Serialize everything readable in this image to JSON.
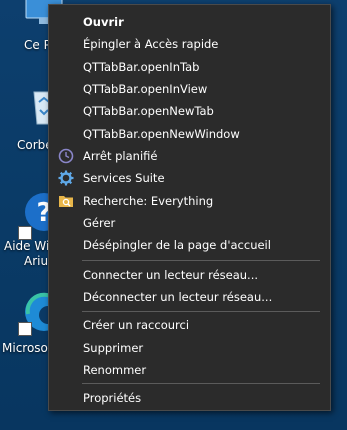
{
  "desktop": {
    "icons": [
      {
        "label": "Ce P",
        "icon": "this-pc-icon"
      },
      {
        "label": "Corbe",
        "icon": "recycle-bin-icon"
      },
      {
        "label": "Aide Wir",
        "label2": "Ariu",
        "icon": "help-icon"
      },
      {
        "label": "Microsof",
        "icon": "edge-icon"
      }
    ]
  },
  "context_menu": {
    "items": [
      {
        "label": "Ouvrir",
        "bold": true
      },
      {
        "label": "Épingler à Accès rapide"
      },
      {
        "label": "QTTabBar.openInTab"
      },
      {
        "label": "QTTabBar.openInView"
      },
      {
        "label": "QTTabBar.openNewTab"
      },
      {
        "label": "QTTabBar.openNewWindow"
      },
      {
        "label": "Arrêt planifié",
        "icon": "clock-icon"
      },
      {
        "label": "Services Suite",
        "icon": "gear-icon"
      },
      {
        "label": "Recherche: Everything",
        "icon": "search-folder-icon"
      },
      {
        "label": "Gérer"
      },
      {
        "label": "Désépingler de la page d'accueil"
      },
      {
        "label": "Connecter un lecteur réseau..."
      },
      {
        "label": "Déconnecter un lecteur réseau..."
      },
      {
        "label": "Créer un raccourci"
      },
      {
        "label": "Supprimer"
      },
      {
        "label": "Renommer"
      },
      {
        "label": "Propriétés"
      }
    ]
  },
  "colors": {
    "desktop_bg": "#0a3b67",
    "menu_bg": "#2b2b2b",
    "menu_border": "#4a4a4a",
    "separator": "#5b5b5b",
    "text": "#ffffff",
    "clock_icon": "#8a86c9",
    "gear_icon": "#5fa9e8",
    "folder_icon": "#e8b64a"
  }
}
